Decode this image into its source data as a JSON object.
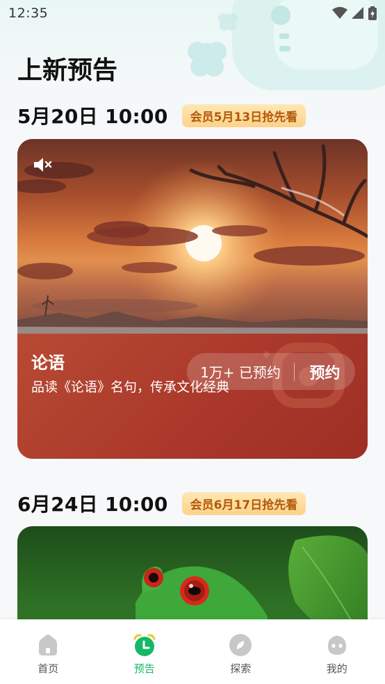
{
  "status_bar": {
    "time": "12:35"
  },
  "page": {
    "title": "上新预告"
  },
  "releases": [
    {
      "date": "5月20日 10:00",
      "vip_badge": "会员5月13日抢先看",
      "title": "论语",
      "description": "品读《论语》名句，传承文化经典",
      "reserve_count": "1万+ 已预约",
      "reserve_button": "预约"
    },
    {
      "date": "6月24日 10:00",
      "vip_badge": "会员6月17日抢先看"
    }
  ],
  "bottom_nav": {
    "items": [
      {
        "label": "首页",
        "icon": "home-icon"
      },
      {
        "label": "预告",
        "icon": "alarm-clock-icon",
        "active": true
      },
      {
        "label": "探索",
        "icon": "compass-icon"
      },
      {
        "label": "我的",
        "icon": "profile-icon"
      }
    ],
    "active_color": "#15b866",
    "inactive_color": "#c8c8c8"
  },
  "colors": {
    "vip_badge_text": "#b05a0c",
    "card_accent": "#b03d2c"
  }
}
